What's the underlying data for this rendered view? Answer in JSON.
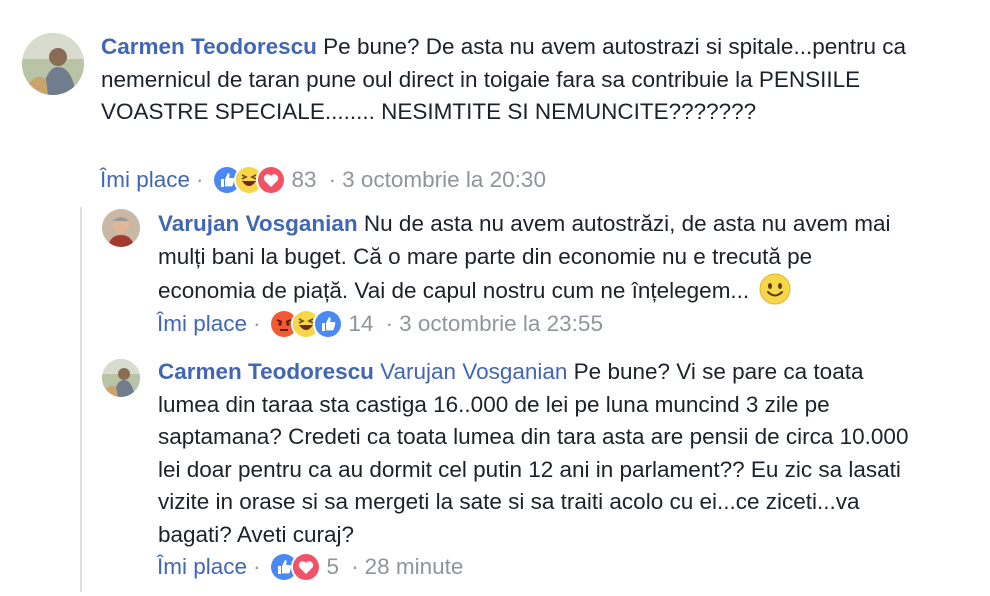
{
  "comments": [
    {
      "author": "Carmen Teodorescu",
      "mention": "",
      "text": "Pe bune? De asta nu avem autostrazi si spitale...pentru ca nemernicul de taran pune oul direct in toigaie fara sa contribuie la PENSIILE VOASTRE SPECIALE........ NESIMTITE SI NEMUNCITE???????",
      "like_label": "Îmi place",
      "reactions": [
        "like",
        "haha",
        "love"
      ],
      "reaction_count": "83",
      "timestamp": "3 octombrie la 20:30"
    },
    {
      "author": "Varujan Vosganian",
      "mention": "",
      "text": "Nu de asta nu avem autostrăzi, de asta nu avem mai mulți bani la buget. Că o mare parte din economie nu e trecută pe economia de piață. Vai de capul nostru cum ne înțelegem...",
      "inline_emoji": "smile-emoji",
      "like_label": "Îmi place",
      "reactions": [
        "angry",
        "haha",
        "like"
      ],
      "reaction_count": "14",
      "timestamp": "3 octombrie la 23:55"
    },
    {
      "author": "Carmen Teodorescu",
      "mention": "Varujan Vosganian",
      "text": "Pe bune? Vi se pare ca toata lumea din taraa sta castiga 16..000 de lei pe luna muncind 3 zile pe saptamana? Credeti ca toata lumea din tara asta are pensii de circa 10.000 lei doar pentru ca au dormit cel putin 12 ani in parlament?? Eu zic sa lasati vizite in orase si sa mergeti la sate si sa traiti acolo cu ei...ce ziceti...va bagati? Aveti curaj?",
      "like_label": "Îmi place",
      "reactions": [
        "like",
        "love"
      ],
      "reaction_count": "5",
      "timestamp": "28 minute"
    }
  ],
  "separator": "·",
  "colors": {
    "link": "#4267b2",
    "meta": "#90949c",
    "text": "#1d2129",
    "like": "#4a89f3",
    "love": "#f25268",
    "haha": "#f7d64a",
    "angry": "#f15a32"
  }
}
